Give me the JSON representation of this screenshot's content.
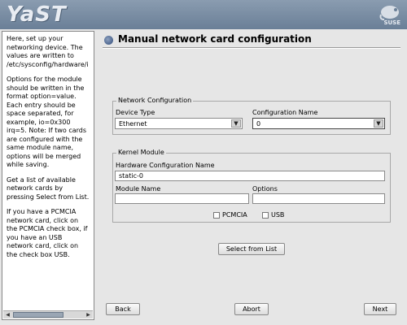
{
  "app": {
    "logo_text": "YaST",
    "brand_text": "SUSE"
  },
  "help": {
    "p1": "Here, set up your networking device. The values are written to /etc/sysconfig/hardware/i",
    "p2": "Options for the module should be written in the format option=value. Each entry should be space separated, for example, io=0x300 irq=5. Note: If two cards are configured with the same module name, options will be merged while saving.",
    "p3": "Get a list of available network cards by pressing Select from List.",
    "p4": "If you have a PCMCIA network card, click on the PCMCIA check box, if you have an USB network card, click on the check box USB."
  },
  "dialog": {
    "title": "Manual network card configuration"
  },
  "network_config": {
    "legend": "Network Configuration",
    "device_type_label": "Device Type",
    "device_type_value": "Ethernet",
    "config_name_label": "Configuration Name",
    "config_name_value": "0"
  },
  "kernel_module": {
    "legend": "Kernel Module",
    "hw_config_label": "Hardware Configuration Name",
    "hw_config_value": "static-0",
    "module_name_label": "Module Name",
    "module_name_value": "",
    "options_label": "Options",
    "options_value": "",
    "pcmcia_label": "PCMCIA",
    "usb_label": "USB"
  },
  "buttons": {
    "select_from_list": "Select from List",
    "back": "Back",
    "abort": "Abort",
    "next": "Next"
  },
  "colors": {
    "header": "#7a8ea6",
    "panel": "#e6e6e6"
  }
}
